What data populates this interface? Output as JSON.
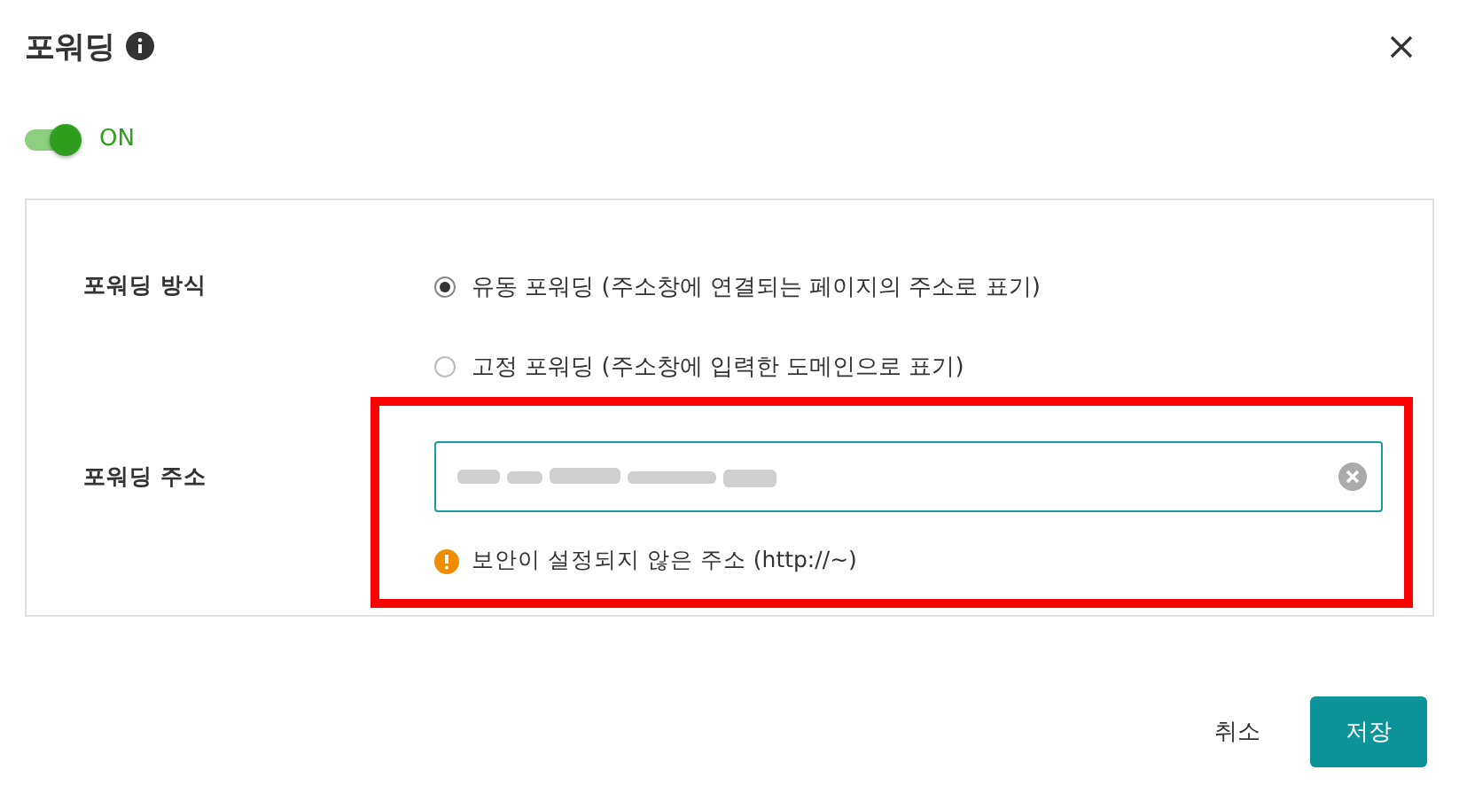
{
  "dialog": {
    "title": "포워딩",
    "toggle": {
      "on": true,
      "label": "ON"
    },
    "fields": [
      {
        "kind": "radio",
        "label": "포워딩 방식",
        "options": [
          {
            "label": "유동 포워딩 (주소창에 연결되는 페이지의 주소로 표기)",
            "selected": true
          },
          {
            "label": "고정 포워딩 (주소창에 입력한 도메인으로 표기)",
            "selected": false
          }
        ]
      },
      {
        "kind": "input",
        "label": "포워딩 주소",
        "warning": "보안이 설정되지 않은 주소 (http://~)"
      }
    ],
    "buttons": [
      {
        "label": "취소",
        "kind": "secondary"
      },
      {
        "label": "저장",
        "kind": "primary"
      }
    ]
  }
}
